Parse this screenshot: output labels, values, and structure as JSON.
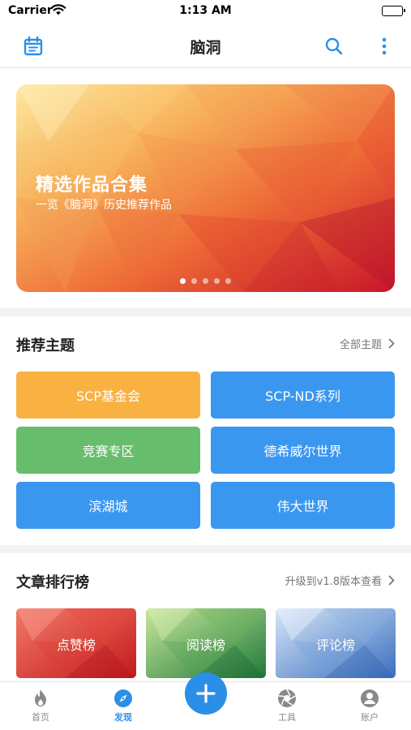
{
  "status_bar": {
    "carrier": "Carrier",
    "time": "1:13 AM"
  },
  "nav": {
    "title": "脑洞"
  },
  "banner": {
    "title": "精选作品合集",
    "subtitle": "一览《脑洞》历史推荐作品",
    "page_count": 5,
    "active_page": 1
  },
  "topics": {
    "title": "推荐主题",
    "link_label": "全部主题",
    "items": [
      {
        "label": "SCP基金会",
        "color": "#f9b141"
      },
      {
        "label": "SCP-ND系列",
        "color": "#3a97f0"
      },
      {
        "label": "竞赛专区",
        "color": "#68bd6c"
      },
      {
        "label": "德希威尔世界",
        "color": "#3a97f0"
      },
      {
        "label": "滨湖城",
        "color": "#3a97f0"
      },
      {
        "label": "伟大世界",
        "color": "#3a97f0"
      }
    ]
  },
  "ranking": {
    "title": "文章排行榜",
    "link_label": "升级到v1.8版本查看",
    "items": [
      {
        "label": "点赞榜",
        "theme": "red"
      },
      {
        "label": "阅读榜",
        "theme": "green"
      },
      {
        "label": "评论榜",
        "theme": "blue"
      }
    ]
  },
  "tab_bar": {
    "tabs": [
      {
        "label": "首页",
        "icon": "flame-icon"
      },
      {
        "label": "发现",
        "icon": "compass-icon",
        "active": true
      },
      {
        "label": "工具",
        "icon": "aperture-icon"
      },
      {
        "label": "账户",
        "icon": "user-icon"
      }
    ],
    "center_icon": "plus-icon"
  },
  "colors": {
    "accent": "#2b8fe8",
    "orange": "#f9b141",
    "green": "#68bd6c",
    "blue": "#3a97f0"
  }
}
